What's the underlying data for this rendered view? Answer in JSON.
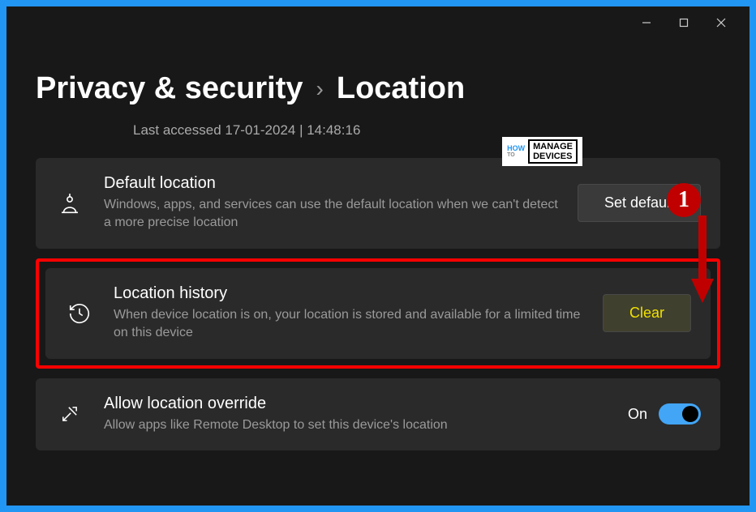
{
  "breadcrumb": {
    "parent": "Privacy & security",
    "separator": "›",
    "current": "Location"
  },
  "lastAccessed": {
    "text": "Last accessed 17-01-2024  |  14:48:16"
  },
  "defaultLocation": {
    "title": "Default location",
    "description": "Windows, apps, and services can use the default location when we can't detect a more precise location",
    "button": "Set default"
  },
  "locationHistory": {
    "title": "Location history",
    "description": "When device location is on, your location is stored and available for a limited time on this device",
    "button": "Clear"
  },
  "allowOverride": {
    "title": "Allow location override",
    "description": "Allow apps like Remote Desktop to set this device's location",
    "state": "On"
  },
  "annotation": {
    "number": "1"
  },
  "watermark": {
    "how": "HOW",
    "to": "TO",
    "line1": "MANAGE",
    "line2": "DEVICES"
  }
}
